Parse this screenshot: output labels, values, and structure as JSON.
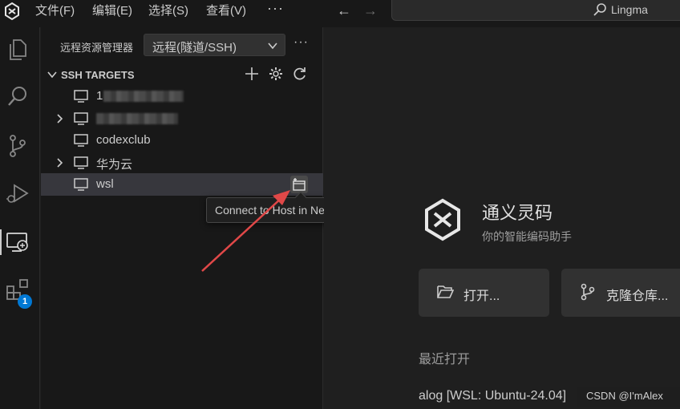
{
  "menu": {
    "file": "文件(F)",
    "edit": "编辑(E)",
    "selection": "选择(S)",
    "view": "查看(V)",
    "more": "···"
  },
  "search": {
    "text": "Lingma"
  },
  "activity": {
    "extensions_badge": "1"
  },
  "sidebar": {
    "title": "远程资源管理器",
    "select_value": "远程(隧道/SSH)",
    "more": "···",
    "section_title": "SSH TARGETS",
    "items": [
      {
        "label": "1",
        "redacted": true,
        "expandable": false
      },
      {
        "label": "",
        "redacted": true,
        "expandable": true
      },
      {
        "label": "codexclub",
        "redacted": false,
        "expandable": false
      },
      {
        "label": "华为云",
        "redacted": false,
        "expandable": true
      },
      {
        "label": "wsl",
        "redacted": false,
        "expandable": false,
        "selected": true
      }
    ]
  },
  "tooltip": {
    "text": "Connect to Host in New Window"
  },
  "welcome": {
    "brand_name": "通义灵码",
    "brand_sub": "你的智能编码助手",
    "open_label": "打开...",
    "clone_label": "克隆仓库...",
    "recent_title": "最近打开",
    "recent_item": "alog [WSL: Ubuntu-24.04]"
  },
  "watermark": "CSDN @I'mAlex",
  "colors": {
    "annotation_arrow": "#e04848",
    "badge": "#0078d4",
    "selected_row": "#37373d"
  }
}
